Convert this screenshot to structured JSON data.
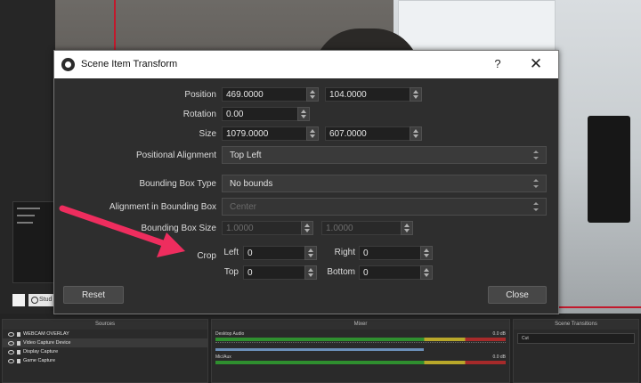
{
  "dialog": {
    "title": "Scene Item Transform",
    "help": "?",
    "close_glyph": "✕",
    "position": {
      "label": "Position",
      "x": "469.0000",
      "y": "104.0000"
    },
    "rotation": {
      "label": "Rotation",
      "value": "0.00"
    },
    "size": {
      "label": "Size",
      "w": "1079.0000",
      "h": "607.0000"
    },
    "positional_alignment": {
      "label": "Positional Alignment",
      "value": "Top Left"
    },
    "bounding_box_type": {
      "label": "Bounding Box Type",
      "value": "No bounds"
    },
    "alignment_in_bounding_box": {
      "label": "Alignment in Bounding Box",
      "value": "Center"
    },
    "bounding_box_size": {
      "label": "Bounding Box Size",
      "w": "1.0000",
      "h": "1.0000"
    },
    "crop": {
      "label": "Crop",
      "left_label": "Left",
      "left": "0",
      "right_label": "Right",
      "right": "0",
      "top_label": "Top",
      "top": "0",
      "bottom_label": "Bottom",
      "bottom": "0"
    },
    "reset_label": "Reset",
    "close_label": "Close"
  },
  "obs": {
    "left_toggle_label": "Stud",
    "sources_title": "Sources",
    "mixer_title": "Mixer",
    "transitions_title": "Scene Transitions",
    "sources": [
      "WEBCAM OVERLAY",
      "Video Capture Device",
      "Display Capture",
      "Game Capture"
    ],
    "mixer": [
      {
        "name": "Desktop Audio",
        "level": "0.0 dB"
      },
      {
        "name": "Mic/Aux",
        "level": "0.0 dB"
      }
    ],
    "transition": "Cut"
  },
  "annotation": {
    "arrow_color": "#ee2d5e"
  }
}
